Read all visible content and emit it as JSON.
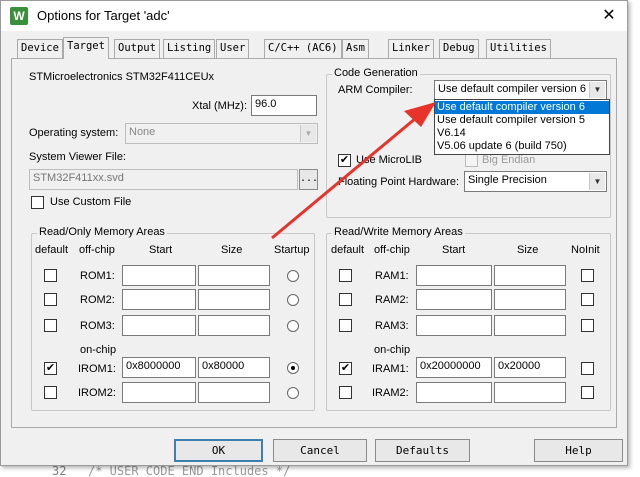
{
  "background_code": {
    "line_number": "32",
    "line_text": "/* USER CODE END Includes */"
  },
  "window": {
    "title": "Options for Target 'adc'",
    "icon_letter": "W",
    "close_glyph": "✕"
  },
  "tabs": [
    {
      "label": "Device"
    },
    {
      "label": "Target"
    },
    {
      "label": "Output"
    },
    {
      "label": "Listing"
    },
    {
      "label": "User"
    },
    {
      "label": "C/C++ (AC6)"
    },
    {
      "label": "Asm"
    },
    {
      "label": "Linker"
    },
    {
      "label": "Debug"
    },
    {
      "label": "Utilities"
    }
  ],
  "active_tab": "Target",
  "device": {
    "name": "STMicroelectronics STM32F411CEUx",
    "xtal_label": "Xtal (MHz):",
    "xtal_value": "96.0",
    "os_label": "Operating system:",
    "os_value": "None",
    "svd_label": "System Viewer File:",
    "svd_value": "STM32F411xx.svd",
    "browse_label": "...",
    "custom_file_label": "Use Custom File"
  },
  "code_generation": {
    "group_title": "Code Generation",
    "compiler_label": "ARM Compiler:",
    "compiler_value": "Use default compiler version 6",
    "compiler_options": [
      "Use default compiler version 6",
      "Use default compiler version 5",
      "V6.14",
      "V5.06 update 6 (build 750)"
    ],
    "microlib_label": "Use MicroLIB",
    "microlib_checked": true,
    "big_endian_label": "Big Endian",
    "fp_label": "Floating Point Hardware:",
    "fp_value": "Single Precision"
  },
  "ro_memory": {
    "group_title": "Read/Only Memory Areas",
    "headers": {
      "default": "default",
      "offchip": "off-chip",
      "start": "Start",
      "size": "Size",
      "extra": "Startup"
    },
    "onchip_label": "on-chip",
    "rows": [
      {
        "name": "ROM1:",
        "start": "",
        "size": "",
        "default": false,
        "startup": false
      },
      {
        "name": "ROM2:",
        "start": "",
        "size": "",
        "default": false,
        "startup": false
      },
      {
        "name": "ROM3:",
        "start": "",
        "size": "",
        "default": false,
        "startup": false
      },
      {
        "name": "IROM1:",
        "start": "0x8000000",
        "size": "0x80000",
        "default": true,
        "startup": true
      },
      {
        "name": "IROM2:",
        "start": "",
        "size": "",
        "default": false,
        "startup": false
      }
    ]
  },
  "rw_memory": {
    "group_title": "Read/Write Memory Areas",
    "headers": {
      "default": "default",
      "offchip": "off-chip",
      "start": "Start",
      "size": "Size",
      "extra": "NoInit"
    },
    "onchip_label": "on-chip",
    "rows": [
      {
        "name": "RAM1:",
        "start": "",
        "size": "",
        "default": false,
        "noinit": false
      },
      {
        "name": "RAM2:",
        "start": "",
        "size": "",
        "default": false,
        "noinit": false
      },
      {
        "name": "RAM3:",
        "start": "",
        "size": "",
        "default": false,
        "noinit": false
      },
      {
        "name": "IRAM1:",
        "start": "0x20000000",
        "size": "0x20000",
        "default": true,
        "noinit": false
      },
      {
        "name": "IRAM2:",
        "start": "",
        "size": "",
        "default": false,
        "noinit": false
      }
    ]
  },
  "buttons": {
    "ok": "OK",
    "cancel": "Cancel",
    "defaults": "Defaults",
    "help": "Help"
  },
  "check_glyph": "✔",
  "annotation_color": "#e8332a"
}
